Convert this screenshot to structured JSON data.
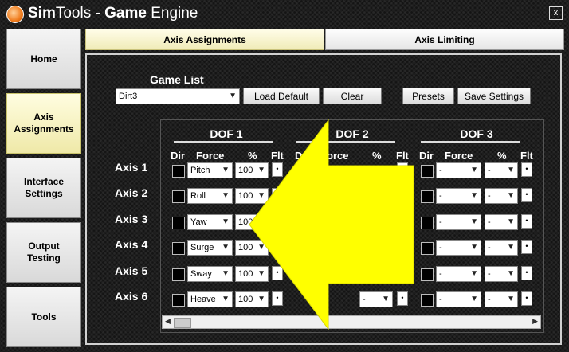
{
  "window": {
    "title_part1": "Sim",
    "title_part2": "Tools - ",
    "title_part3": "Game",
    "title_part4": " Engine",
    "close": "x"
  },
  "sidebar": {
    "items": [
      {
        "label_line1": "Home",
        "label_line2": ""
      },
      {
        "label_line1": "Axis",
        "label_line2": "Assignments"
      },
      {
        "label_line1": "Interface",
        "label_line2": "Settings"
      },
      {
        "label_line1": "Output",
        "label_line2": "Testing"
      },
      {
        "label_line1": "Tools",
        "label_line2": ""
      }
    ],
    "active_index": 1
  },
  "tabs": [
    {
      "label": "Axis Assignments"
    },
    {
      "label": "Axis Limiting"
    }
  ],
  "game_list": {
    "label": "Game List",
    "selected": "Dirt3"
  },
  "buttons": {
    "load_default": "Load Default",
    "clear": "Clear",
    "presets": "Presets",
    "save_settings": "Save Settings"
  },
  "dof": {
    "titles": [
      "DOF 1",
      "DOF 2",
      "DOF 3"
    ],
    "col_dir": "Dir",
    "col_force": "Force",
    "col_pct": "%",
    "col_flt": "Flt",
    "dof2_force_fragment": "orce",
    "dof2_dir_fragment": "D"
  },
  "axes": [
    {
      "label": "Axis 1",
      "dof1_force": "Pitch",
      "dof1_pct": "100",
      "dof3_force": "-",
      "dof3_pct": "-"
    },
    {
      "label": "Axis 2",
      "dof1_force": "Roll",
      "dof1_pct": "100",
      "dof3_force": "-",
      "dof3_pct": "-"
    },
    {
      "label": "Axis 3",
      "dof1_force": "Yaw",
      "dof1_pct": "100",
      "dof3_force": "-",
      "dof3_pct": "-"
    },
    {
      "label": "Axis 4",
      "dof1_force": "Surge",
      "dof1_pct": "100",
      "dof3_force": "-",
      "dof3_pct": "-"
    },
    {
      "label": "Axis 5",
      "dof1_force": "Sway",
      "dof1_pct": "100",
      "dof3_force": "-",
      "dof3_pct": "-"
    },
    {
      "label": "Axis 6",
      "dof1_force": "Heave",
      "dof1_pct": "100",
      "dof3_force": "-",
      "dof3_pct": "-",
      "dof2_pct": "-"
    }
  ],
  "colors": {
    "arrow_fill": "#ffff00",
    "active_nav": "#f3efb4"
  }
}
